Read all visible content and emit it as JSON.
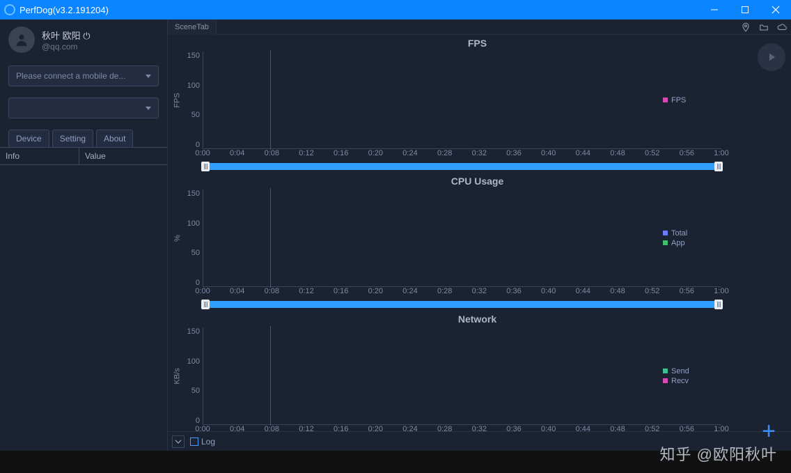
{
  "window": {
    "title": "PerfDog(v3.2.191204)"
  },
  "user": {
    "name": "秋叶 欧阳 ⏻",
    "email": "@qq.com"
  },
  "dropdowns": {
    "device_placeholder": "Please connect a mobile de..."
  },
  "sidebar_tabs": {
    "device": "Device",
    "setting": "Setting",
    "about": "About"
  },
  "info_table": {
    "col1": "Info",
    "col2": "Value"
  },
  "toolbar": {
    "scene": "SceneTab"
  },
  "footer": {
    "log": "Log"
  },
  "watermark": "知乎 @欧阳秋叶",
  "legend": {
    "fps": "FPS",
    "total": "Total",
    "app": "App",
    "send": "Send",
    "recv": "Recv"
  },
  "colors": {
    "fps": "#d64bb4",
    "total": "#6d7cff",
    "app": "#3fbf6f",
    "send": "#3fbf8f",
    "recv": "#d64bb4"
  },
  "chart_data": [
    {
      "type": "line",
      "title": "FPS",
      "xlabel": "",
      "ylabel": "FPS",
      "ylim": [
        0,
        150
      ],
      "yticks": [
        0,
        50,
        100,
        150
      ],
      "xticks": [
        "0:00",
        "0:04",
        "0:08",
        "0:12",
        "0:16",
        "0:20",
        "0:24",
        "0:28",
        "0:32",
        "0:36",
        "0:40",
        "0:44",
        "0:48",
        "0:52",
        "0:56",
        "1:00"
      ],
      "series": [
        {
          "name": "FPS",
          "values": []
        }
      ],
      "cursor_time": "0:08"
    },
    {
      "type": "line",
      "title": "CPU Usage",
      "xlabel": "",
      "ylabel": "%",
      "ylim": [
        0,
        150
      ],
      "yticks": [
        0,
        50,
        100,
        150
      ],
      "xticks": [
        "0:00",
        "0:04",
        "0:08",
        "0:12",
        "0:16",
        "0:20",
        "0:24",
        "0:28",
        "0:32",
        "0:36",
        "0:40",
        "0:44",
        "0:48",
        "0:52",
        "0:56",
        "1:00"
      ],
      "series": [
        {
          "name": "Total",
          "values": []
        },
        {
          "name": "App",
          "values": []
        }
      ],
      "cursor_time": "0:08"
    },
    {
      "type": "line",
      "title": "Network",
      "xlabel": "",
      "ylabel": "KB/s",
      "ylim": [
        0,
        150
      ],
      "yticks": [
        0,
        50,
        100,
        150
      ],
      "xticks": [
        "0:00",
        "0:04",
        "0:08",
        "0:12",
        "0:16",
        "0:20",
        "0:24",
        "0:28",
        "0:32",
        "0:36",
        "0:40",
        "0:44",
        "0:48",
        "0:52",
        "0:56",
        "1:00"
      ],
      "series": [
        {
          "name": "Send",
          "values": []
        },
        {
          "name": "Recv",
          "values": []
        }
      ],
      "cursor_time": "0:08"
    }
  ]
}
